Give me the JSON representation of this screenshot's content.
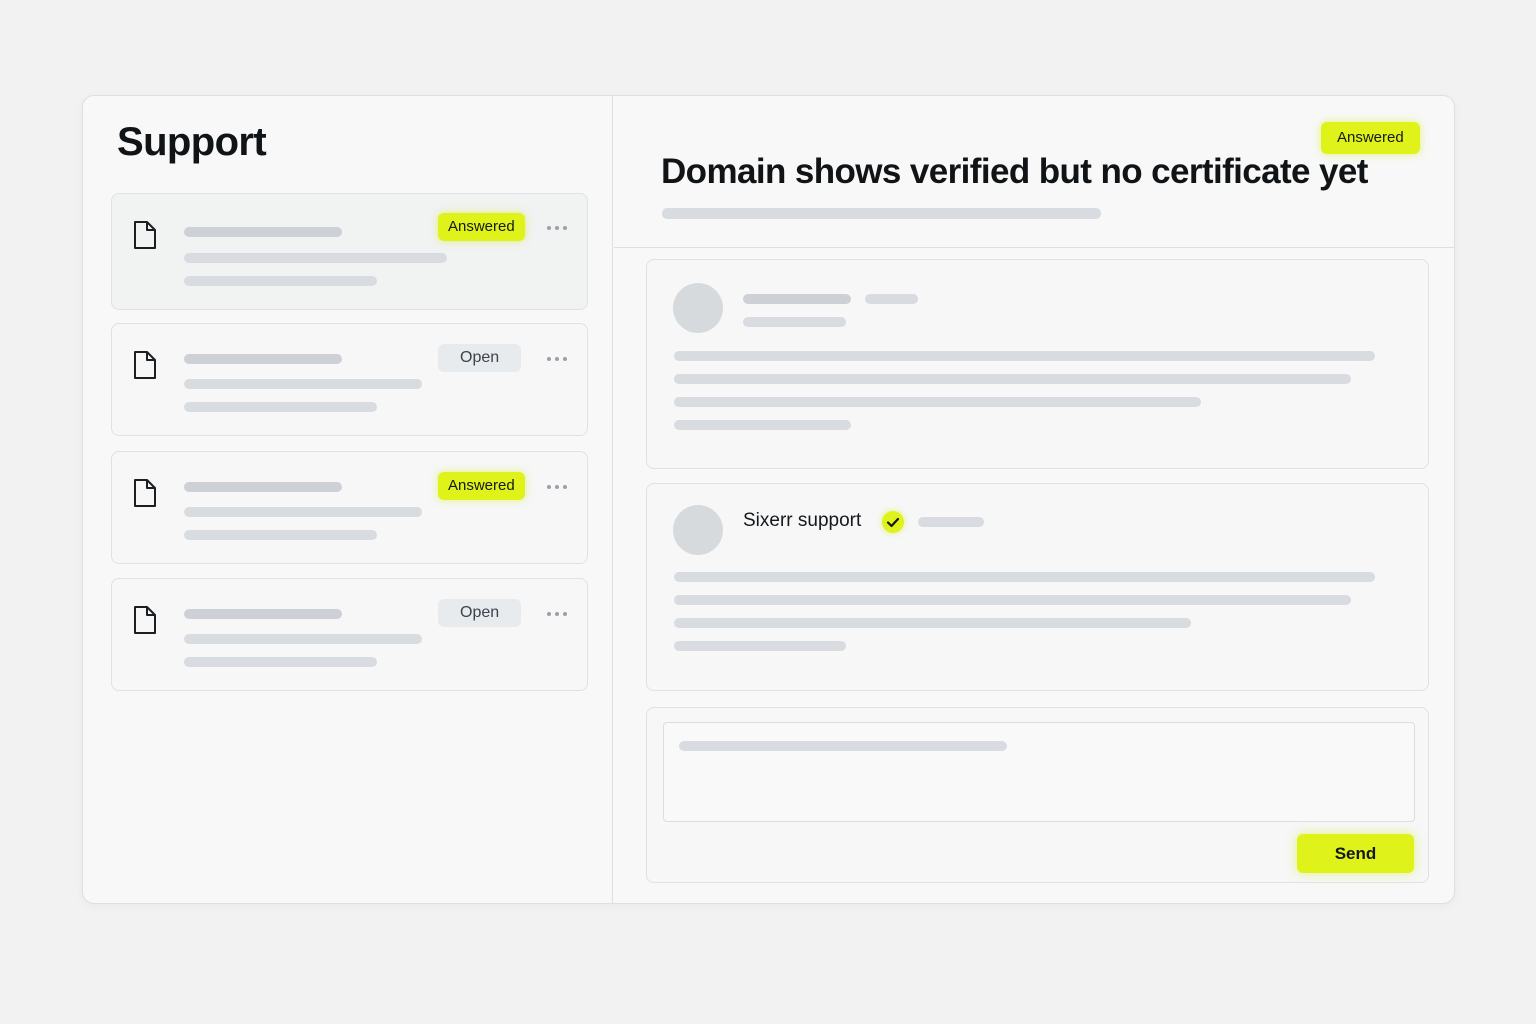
{
  "sidebar": {
    "title": "Support",
    "tickets": [
      {
        "status": "Answered",
        "icon": "document-icon",
        "selected": true
      },
      {
        "status": "Open",
        "icon": "document-icon",
        "selected": false
      },
      {
        "status": "Answered",
        "icon": "document-icon",
        "selected": false
      },
      {
        "status": "Open",
        "icon": "document-icon",
        "selected": false
      }
    ]
  },
  "ticket": {
    "title": "Domain shows verified but no certificate yet",
    "status": "Answered"
  },
  "messages": [
    {
      "author": "",
      "verified": false
    },
    {
      "author": "Sixerr support",
      "verified": true
    }
  ],
  "reply": {
    "send_label": "Send"
  },
  "colors": {
    "accent": "#dff21a",
    "background": "#f1f2f1",
    "placeholder_bar": "#d8dce0",
    "open_badge": "#e8ebee"
  }
}
